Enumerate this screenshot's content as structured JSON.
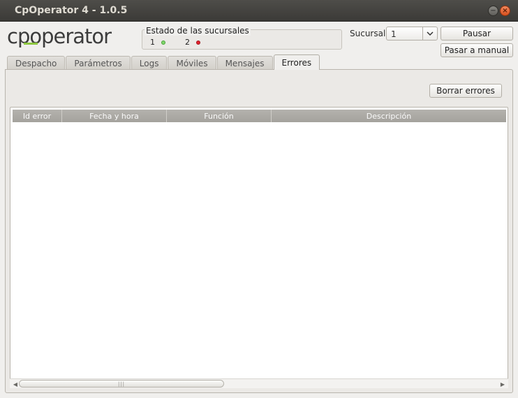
{
  "window": {
    "title": "CpOperator 4 - 1.0.5",
    "minimize_glyph": "−",
    "close_glyph": "×"
  },
  "logo": {
    "icon": "cpoperator-logo",
    "text": "cpoperator"
  },
  "status": {
    "legend": "Estado de las sucursales",
    "branches": [
      {
        "id": "1",
        "state": "ok",
        "color": "#7fd66b"
      },
      {
        "id": "2",
        "state": "error",
        "color": "#e3222d"
      }
    ]
  },
  "sucursal": {
    "label": "Sucursal",
    "selected": "1"
  },
  "buttons": {
    "pausar": "Pausar",
    "manual": "Pasar a manual",
    "borrar": "Borrar errores"
  },
  "tabs": [
    {
      "label": "Despacho",
      "active": false
    },
    {
      "label": "Parámetros",
      "active": false
    },
    {
      "label": "Logs",
      "active": false
    },
    {
      "label": "Móviles",
      "active": false
    },
    {
      "label": "Mensajes",
      "active": false
    },
    {
      "label": "Errores",
      "active": true
    }
  ],
  "table": {
    "columns": [
      "Id error",
      "Fecha y hora",
      "Función",
      "Descripción"
    ],
    "rows": []
  },
  "scrollbar": {
    "grip": "|||"
  },
  "colors": {
    "titlebar": "#3c3b37",
    "close_button": "#e95420",
    "header": "#a9a7a2"
  }
}
